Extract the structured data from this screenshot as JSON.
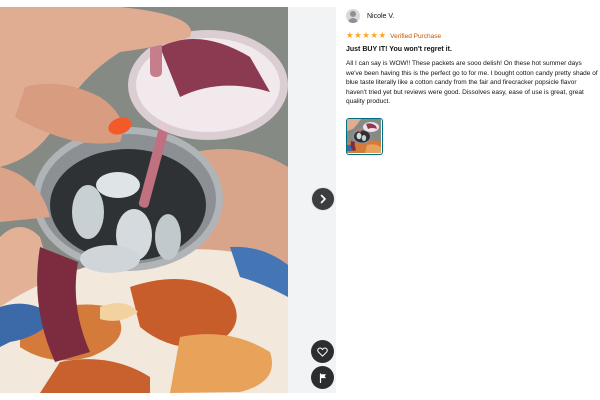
{
  "review": {
    "reviewer_name": "Nicole V.",
    "rating": 5,
    "rating_max": 5,
    "badge": "Verified Purchase",
    "title": "Just BUY IT! You won't regret it.",
    "body": "All I can say is WOW!! These packets are sooo delish! On these hot summer days we've been having this is the perfect go to for me. I bought cotton candy pretty shade of blue taste literally like a cotton candy from the fair and firecracker popsicle flavor haven't tried yet but reviews were good. Dissolves easy, ease of use is great, great quality product."
  },
  "icons": {
    "next": "chevron-right-icon",
    "like": "heart-icon",
    "report": "flag-icon",
    "avatar": "user-icon",
    "star": "star-icon"
  },
  "colors": {
    "star": "#ffa41c",
    "verified": "#c45500",
    "thumbnail_border": "#007185",
    "control_button": "#2b2d2f"
  }
}
